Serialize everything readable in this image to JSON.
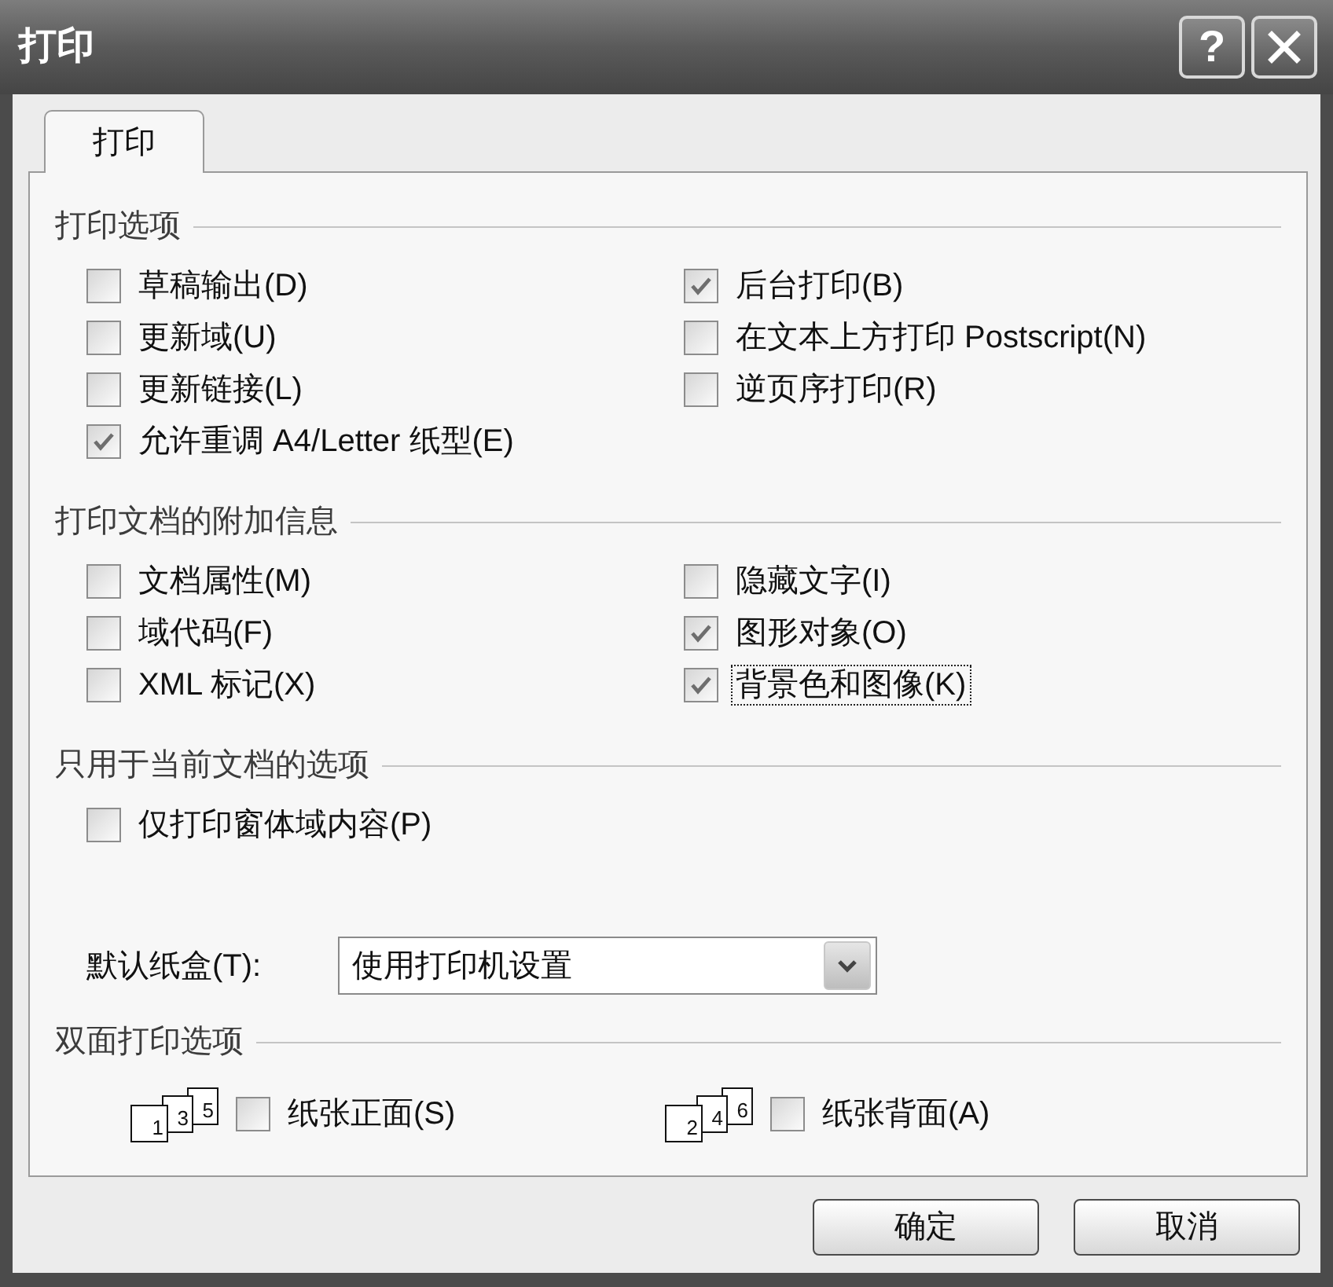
{
  "window": {
    "title": "打印"
  },
  "title_buttons": [
    {
      "kind": "help",
      "label": "?"
    },
    {
      "kind": "close"
    }
  ],
  "tabs": [
    {
      "label": "打印",
      "selected": true
    }
  ],
  "sections": [
    {
      "title": "打印选项",
      "left": [
        {
          "label": "草稿输出(D)",
          "checked": false,
          "focused": false
        },
        {
          "label": "更新域(U)",
          "checked": false,
          "focused": false
        },
        {
          "label": "更新链接(L)",
          "checked": false,
          "focused": false
        },
        {
          "label": "允许重调 A4/Letter 纸型(E)",
          "checked": true,
          "focused": false
        }
      ],
      "right": [
        {
          "label": "后台打印(B)",
          "checked": true,
          "focused": false
        },
        {
          "label": "在文本上方打印 Postscript(N)",
          "checked": false,
          "focused": false
        },
        {
          "label": "逆页序打印(R)",
          "checked": false,
          "focused": false
        }
      ]
    },
    {
      "title": "打印文档的附加信息",
      "left": [
        {
          "label": "文档属性(M)",
          "checked": false,
          "focused": false
        },
        {
          "label": "域代码(F)",
          "checked": false,
          "focused": false
        },
        {
          "label": "XML 标记(X)",
          "checked": false,
          "focused": false
        }
      ],
      "right": [
        {
          "label": "隐藏文字(I)",
          "checked": false,
          "focused": false
        },
        {
          "label": "图形对象(O)",
          "checked": true,
          "focused": false
        },
        {
          "label": "背景色和图像(K)",
          "checked": true,
          "focused": true
        }
      ]
    },
    {
      "title": "只用于当前文档的选项",
      "left": [
        {
          "label": "仅打印窗体域内容(P)",
          "checked": false,
          "focused": false
        }
      ]
    }
  ],
  "paper_tray": {
    "label": "默认纸盒(T):",
    "value": "使用打印机设置"
  },
  "duplex": {
    "title": "双面打印选项",
    "options": [
      {
        "pages": [
          "1",
          "3",
          "5"
        ],
        "label": "纸张正面(S)",
        "checked": false
      },
      {
        "pages": [
          "2",
          "4",
          "6"
        ],
        "label": "纸张背面(A)",
        "checked": false
      }
    ]
  },
  "buttons": [
    {
      "label": "确定"
    },
    {
      "label": "取消"
    }
  ]
}
